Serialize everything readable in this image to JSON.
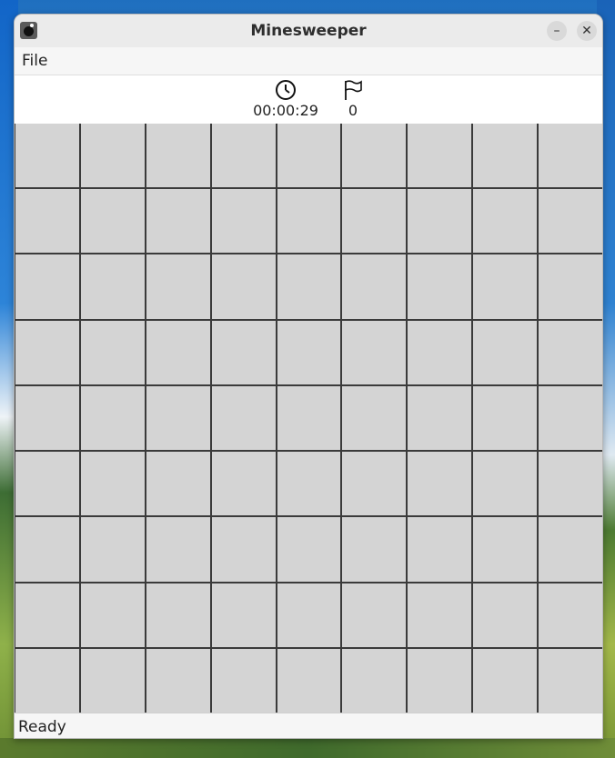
{
  "window": {
    "title": "Minesweeper"
  },
  "menu": {
    "file_label": "File"
  },
  "header": {
    "timer": "00:00:29",
    "flags": "0"
  },
  "board": {
    "rows": 9,
    "cols": 9,
    "cell_color": "#d4d4d4"
  },
  "status": {
    "text": "Ready"
  },
  "icons": {
    "app": "mine-icon",
    "timer": "clock-icon",
    "flags": "flag-icon",
    "minimize": "minimize-icon",
    "close": "close-icon"
  }
}
